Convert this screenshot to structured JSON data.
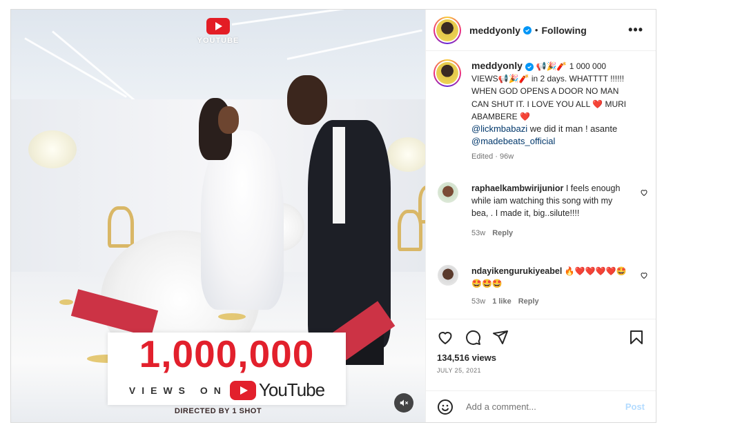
{
  "post": {
    "username": "meddyonly",
    "follow_state": "Following",
    "more_label": "•••"
  },
  "media": {
    "watermark_text": "YOUTUBE",
    "banner_count": "1,000,000",
    "banner_views_on": "VIEWS ON",
    "banner_youtube": "YouTube",
    "directed_by": "DIRECTED BY 1 SHOT"
  },
  "caption": {
    "username": "meddyonly",
    "text_part1": "📢🎉🧨 1 000 000 VIEWS📢🎉🧨 in 2 days. WHATTTT !!!!!! WHEN GOD OPENS A DOOR NO MAN CAN SHUT IT. I LOVE YOU ALL ❤️ MURI ABAMBERE ❤️",
    "mention1": "@lickmbabazi",
    "text_part2": " we did it man ! asante ",
    "mention2": "@madebeats_official",
    "edited": "Edited",
    "time": "96w"
  },
  "comments": [
    {
      "username": "raphaelkambwirijunior",
      "text": "I feels enough while iam watching this song with my bea, . I made it, big..silute!!!!",
      "time": "53w",
      "likes": "",
      "reply": "Reply"
    },
    {
      "username": "ndayikengurukiyeabel",
      "text": "🔥❤️❤️❤️❤️🤩🤩🤩🤩",
      "time": "53w",
      "likes": "1 like",
      "reply": "Reply"
    }
  ],
  "stats": {
    "views": "134,516 views",
    "date": "JULY 25, 2021"
  },
  "add_comment": {
    "placeholder": "Add a comment...",
    "post_label": "Post"
  },
  "colors": {
    "link": "#00376b",
    "verified": "#0095f6",
    "post_disabled": "#b3dbff",
    "banner_red": "#e2202c",
    "youtube_red": "#e31d25"
  }
}
